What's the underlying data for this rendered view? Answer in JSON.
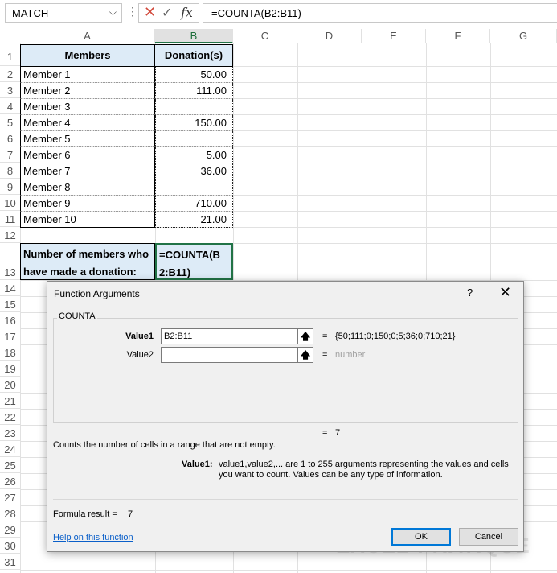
{
  "formula_bar": {
    "name_box": "MATCH",
    "formula": "=COUNTA(B2:B11)"
  },
  "columns": [
    "A",
    "B",
    "C",
    "D",
    "E",
    "F",
    "G"
  ],
  "rows": [
    "1",
    "2",
    "3",
    "4",
    "5",
    "6",
    "7",
    "8",
    "9",
    "10",
    "11",
    "12",
    "13",
    "14",
    "15",
    "16",
    "17",
    "18",
    "19",
    "20",
    "21",
    "22",
    "23",
    "24",
    "25",
    "26",
    "27",
    "28",
    "29",
    "30",
    "31"
  ],
  "table": {
    "header_members": "Members",
    "header_donations": "Donation(s)",
    "members": [
      "Member 1",
      "Member 2",
      "Member 3",
      "Member 4",
      "Member 5",
      "Member 6",
      "Member 7",
      "Member 8",
      "Member 9",
      "Member 10"
    ],
    "donations": [
      "50.00",
      "111.00",
      "",
      "150.00",
      "",
      "5.00",
      "36.00",
      "",
      "710.00",
      "21.00"
    ]
  },
  "question_cell": "Number of members who have made a donation:",
  "formula_cell": "=COUNTA(B2:B11)",
  "dialog": {
    "title": "Function Arguments",
    "help_glyph": "?",
    "close_glyph": "✕",
    "function_name": "COUNTA",
    "value1_label": "Value1",
    "value1_input": "B2:B11",
    "value1_result": "{50;111;0;150;0;5;36;0;710;21}",
    "value2_label": "Value2",
    "value2_input": "",
    "value2_result": "number",
    "equals": "=",
    "total_result": "7",
    "description": "Counts the number of cells in a range that are not empty.",
    "arg_desc_label": "Value1:",
    "arg_desc_line1": "value1,value2,... are 1 to 255 arguments representing the values and cells",
    "arg_desc_line2": "you want to count. Values can be any type of information.",
    "formula_result_label": "Formula result =",
    "formula_result_value": "7",
    "help_link": "Help on this function",
    "ok_label": "OK",
    "cancel_label": "Cancel"
  },
  "watermark": "EXCEL-PRATIQUE"
}
